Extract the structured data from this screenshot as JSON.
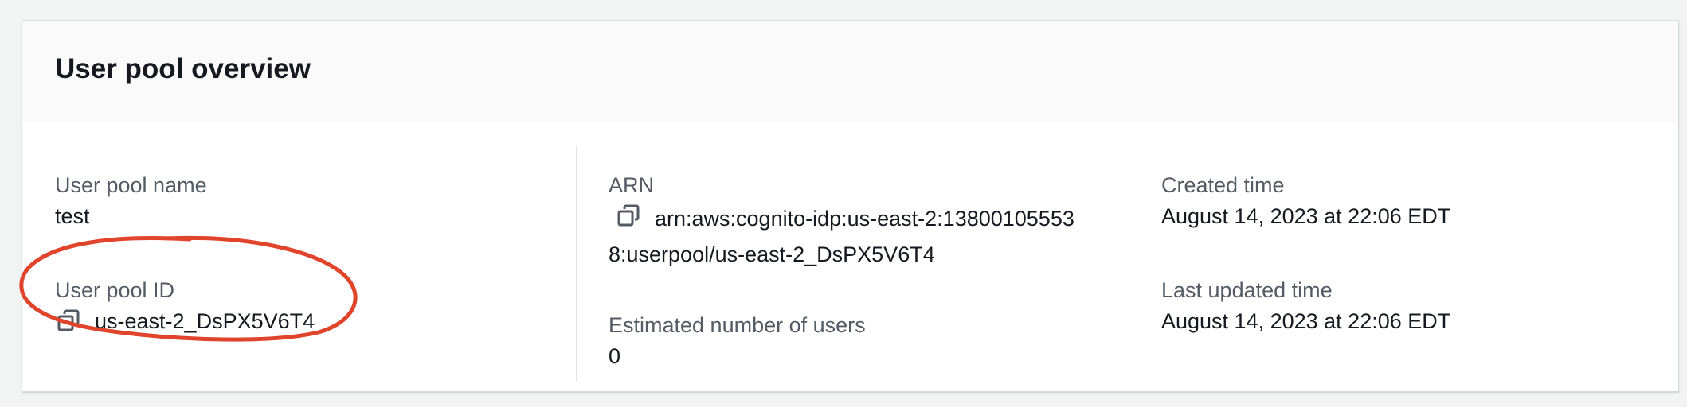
{
  "panel": {
    "title": "User pool overview"
  },
  "fields": {
    "user_pool_name": {
      "label": "User pool name",
      "value": "test"
    },
    "user_pool_id": {
      "label": "User pool ID",
      "value": "us-east-2_DsPX5V6T4",
      "icon": "copy-icon"
    },
    "arn": {
      "label": "ARN",
      "value": "arn:aws:cognito-idp:us-east-2:138001055538:userpool/us-east-2_DsPX5V6T4",
      "icon": "copy-icon"
    },
    "estimated_users": {
      "label": "Estimated number of users",
      "value": "0"
    },
    "created_time": {
      "label": "Created time",
      "value": "August 14, 2023 at 22:06 EDT"
    },
    "last_updated_time": {
      "label": "Last updated time",
      "value": "August 14, 2023 at 22:06 EDT"
    }
  },
  "colors": {
    "annotation": "#e0452b",
    "label": "#545b64",
    "text": "#16191f"
  }
}
